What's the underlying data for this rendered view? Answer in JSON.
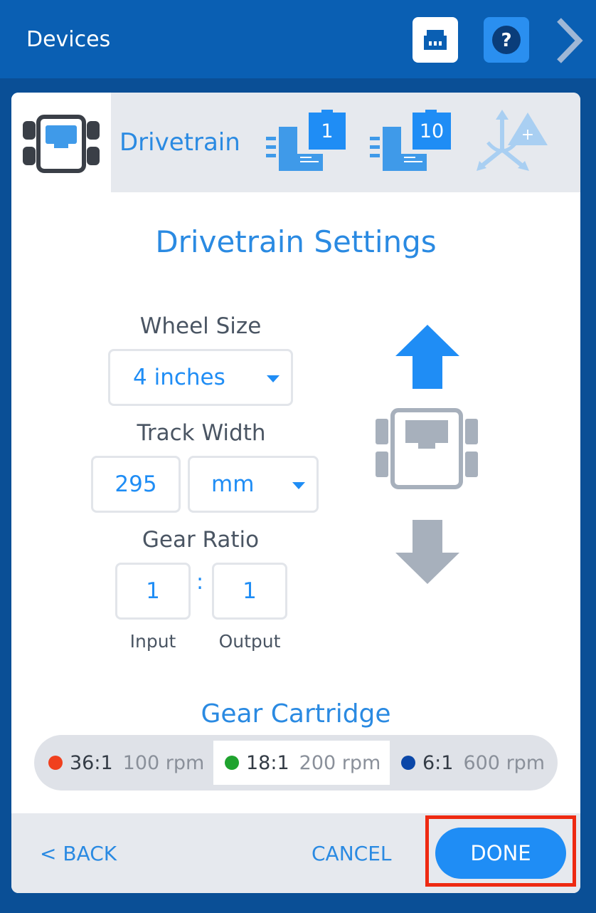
{
  "header": {
    "title": "Devices",
    "port_icon": "ethernet-port-icon",
    "help_icon": "question-icon",
    "help_symbol": "?",
    "next_icon": "chevron-right-icon"
  },
  "tabs": {
    "drivetrain_label": "Drivetrain",
    "motor_1_badge": "1",
    "motor_10_badge": "10",
    "add_sensor_symbol": "+"
  },
  "settings": {
    "title": "Drivetrain Settings",
    "wheel_size": {
      "label": "Wheel Size",
      "value": "4 inches"
    },
    "track_width": {
      "label": "Track Width",
      "value": "295",
      "unit": "mm"
    },
    "gear_ratio": {
      "label": "Gear Ratio",
      "input": "1",
      "separator": ":",
      "output": "1",
      "input_label": "Input",
      "output_label": "Output"
    }
  },
  "cartridge": {
    "title": "Gear Cartridge",
    "options": [
      {
        "ratio": "36:1",
        "rpm": "100 rpm",
        "color": "#f0401e",
        "selected": false
      },
      {
        "ratio": "18:1",
        "rpm": "200 rpm",
        "color": "#1fa32e",
        "selected": true
      },
      {
        "ratio": "6:1",
        "rpm": "600 rpm",
        "color": "#0b47a8",
        "selected": false
      }
    ]
  },
  "footer": {
    "back": "< BACK",
    "cancel": "CANCEL",
    "done": "DONE"
  },
  "colors": {
    "accent": "#1f8df5",
    "header": "#0a5fb3",
    "highlight": "#ee2a12"
  }
}
